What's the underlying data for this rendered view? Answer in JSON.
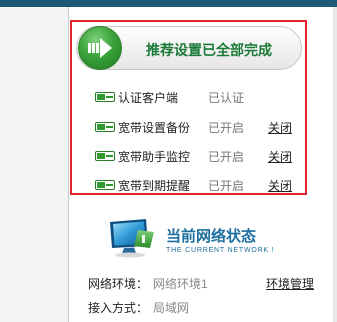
{
  "banner": {
    "title": "推荐设置已全部完成"
  },
  "items": [
    {
      "label": "认证客户端",
      "status": "已认证",
      "action": ""
    },
    {
      "label": "宽带设置备份",
      "status": "已开启",
      "action": "关闭"
    },
    {
      "label": "宽带助手监控",
      "status": "已开启",
      "action": "关闭"
    },
    {
      "label": "宽带到期提醒",
      "status": "已开启",
      "action": "关闭"
    }
  ],
  "network_status": {
    "title": "当前网络状态",
    "subtitle": "THE CURRENT NETWORK !",
    "rows": [
      {
        "label": "网络环境：",
        "value": "网络环境1",
        "link": "环境管理"
      },
      {
        "label": "接入方式：",
        "value": "局域网",
        "link": ""
      }
    ]
  },
  "colors": {
    "highlight_border": "#e0262b",
    "banner_text": "#1a7a36",
    "status_title": "#1c6f9e",
    "top_bar": "#1d5a77"
  }
}
